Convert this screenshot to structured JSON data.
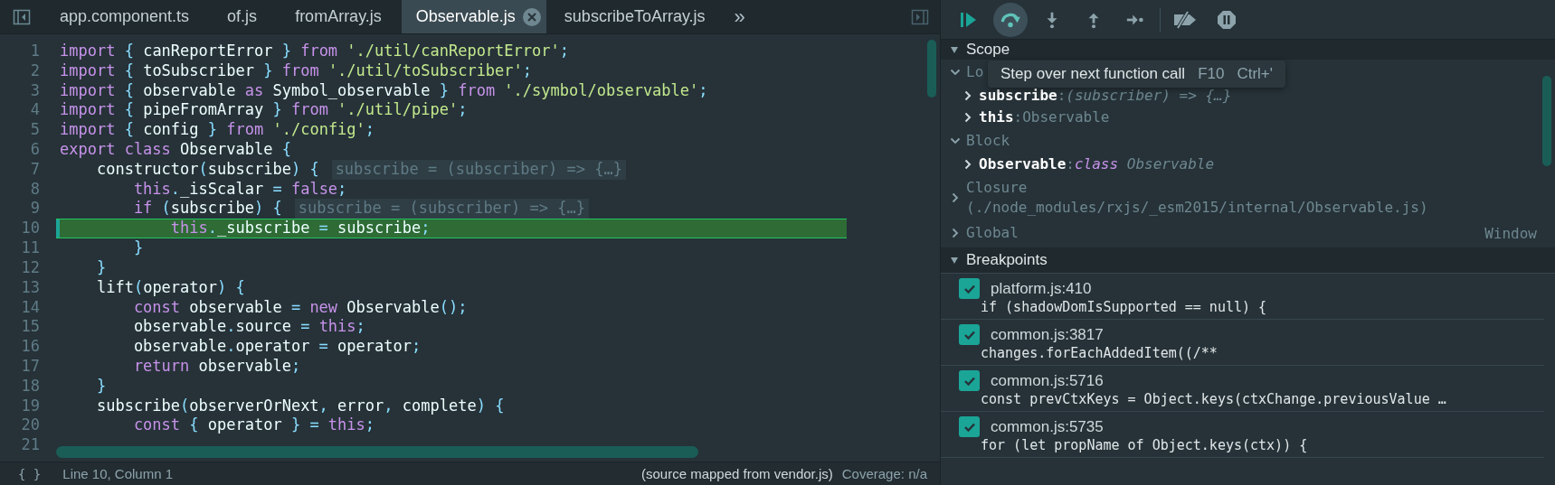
{
  "tabs": [
    {
      "label": "app.component.ts",
      "selected": false
    },
    {
      "label": "of.js",
      "selected": false
    },
    {
      "label": "fromArray.js",
      "selected": false
    },
    {
      "label": "Observable.js",
      "selected": true
    },
    {
      "label": "subscribeToArray.js",
      "selected": false
    }
  ],
  "tabs_overflow": "»",
  "code_lines": [
    {
      "number": "1",
      "current": false,
      "tokens": [
        {
          "kind": "keyword",
          "text": "import"
        },
        {
          "kind": "punct",
          "text": " { "
        },
        {
          "kind": "plain",
          "text": "canReportError"
        },
        {
          "kind": "punct",
          "text": " } "
        },
        {
          "kind": "keyword",
          "text": "from"
        },
        {
          "kind": "string",
          "text": " './util/canReportError'"
        },
        {
          "kind": "punct",
          "text": ";"
        }
      ]
    },
    {
      "number": "2",
      "current": false,
      "tokens": [
        {
          "kind": "keyword",
          "text": "import"
        },
        {
          "kind": "punct",
          "text": " { "
        },
        {
          "kind": "plain",
          "text": "toSubscriber"
        },
        {
          "kind": "punct",
          "text": " } "
        },
        {
          "kind": "keyword",
          "text": "from"
        },
        {
          "kind": "string",
          "text": " './util/toSubscriber'"
        },
        {
          "kind": "punct",
          "text": ";"
        }
      ]
    },
    {
      "number": "3",
      "current": false,
      "tokens": [
        {
          "kind": "keyword",
          "text": "import"
        },
        {
          "kind": "punct",
          "text": " { "
        },
        {
          "kind": "plain",
          "text": "observable "
        },
        {
          "kind": "keyword",
          "text": "as"
        },
        {
          "kind": "plain",
          "text": " Symbol_observable"
        },
        {
          "kind": "punct",
          "text": " } "
        },
        {
          "kind": "keyword",
          "text": "from"
        },
        {
          "kind": "string",
          "text": " './symbol/observable'"
        },
        {
          "kind": "punct",
          "text": ";"
        }
      ]
    },
    {
      "number": "4",
      "current": false,
      "tokens": [
        {
          "kind": "keyword",
          "text": "import"
        },
        {
          "kind": "punct",
          "text": " { "
        },
        {
          "kind": "plain",
          "text": "pipeFromArray"
        },
        {
          "kind": "punct",
          "text": " } "
        },
        {
          "kind": "keyword",
          "text": "from"
        },
        {
          "kind": "string",
          "text": " './util/pipe'"
        },
        {
          "kind": "punct",
          "text": ";"
        }
      ]
    },
    {
      "number": "5",
      "current": false,
      "tokens": [
        {
          "kind": "keyword",
          "text": "import"
        },
        {
          "kind": "punct",
          "text": " { "
        },
        {
          "kind": "plain",
          "text": "config"
        },
        {
          "kind": "punct",
          "text": " } "
        },
        {
          "kind": "keyword",
          "text": "from"
        },
        {
          "kind": "string",
          "text": " './config'"
        },
        {
          "kind": "punct",
          "text": ";"
        }
      ]
    },
    {
      "number": "6",
      "current": false,
      "tokens": [
        {
          "kind": "keyword",
          "text": "export class"
        },
        {
          "kind": "plain",
          "text": " Observable"
        },
        {
          "kind": "punct",
          "text": " {"
        }
      ]
    },
    {
      "number": "7",
      "current": false,
      "tokens": [
        {
          "kind": "plain",
          "text": "    constructor"
        },
        {
          "kind": "punct",
          "text": "("
        },
        {
          "kind": "plain",
          "text": "subscribe"
        },
        {
          "kind": "punct",
          "text": ") {"
        }
      ],
      "hint": "subscribe = (subscriber) => {…}"
    },
    {
      "number": "8",
      "current": false,
      "tokens": [
        {
          "kind": "keyword",
          "text": "        this"
        },
        {
          "kind": "punct",
          "text": "."
        },
        {
          "kind": "plain",
          "text": "_isScalar"
        },
        {
          "kind": "punct",
          "text": " = "
        },
        {
          "kind": "keyword",
          "text": "false"
        },
        {
          "kind": "punct",
          "text": ";"
        }
      ]
    },
    {
      "number": "9",
      "current": false,
      "tokens": [
        {
          "kind": "keyword",
          "text": "        if"
        },
        {
          "kind": "punct",
          "text": " ("
        },
        {
          "kind": "plain",
          "text": "subscribe"
        },
        {
          "kind": "punct",
          "text": ") {"
        }
      ],
      "hint": "subscribe = (subscriber) => {…}"
    },
    {
      "number": "10",
      "current": true,
      "tokens": [
        {
          "kind": "keyword",
          "text": "            this"
        },
        {
          "kind": "punct",
          "text": "."
        },
        {
          "kind": "plain",
          "text": "_subscribe"
        },
        {
          "kind": "punct",
          "text": " = "
        },
        {
          "kind": "plain",
          "text": "subscribe"
        },
        {
          "kind": "punct",
          "text": ";"
        }
      ]
    },
    {
      "number": "11",
      "current": false,
      "tokens": [
        {
          "kind": "punct",
          "text": "        }"
        }
      ]
    },
    {
      "number": "12",
      "current": false,
      "tokens": [
        {
          "kind": "punct",
          "text": "    }"
        }
      ]
    },
    {
      "number": "13",
      "current": false,
      "tokens": [
        {
          "kind": "plain",
          "text": "    lift"
        },
        {
          "kind": "punct",
          "text": "("
        },
        {
          "kind": "plain",
          "text": "operator"
        },
        {
          "kind": "punct",
          "text": ") {"
        }
      ]
    },
    {
      "number": "14",
      "current": false,
      "tokens": [
        {
          "kind": "keyword",
          "text": "        const"
        },
        {
          "kind": "plain",
          "text": " observable"
        },
        {
          "kind": "punct",
          "text": " = "
        },
        {
          "kind": "keyword",
          "text": "new"
        },
        {
          "kind": "plain",
          "text": " Observable"
        },
        {
          "kind": "punct",
          "text": "();"
        }
      ]
    },
    {
      "number": "15",
      "current": false,
      "tokens": [
        {
          "kind": "plain",
          "text": "        observable"
        },
        {
          "kind": "punct",
          "text": "."
        },
        {
          "kind": "plain",
          "text": "source"
        },
        {
          "kind": "punct",
          "text": " = "
        },
        {
          "kind": "keyword",
          "text": "this"
        },
        {
          "kind": "punct",
          "text": ";"
        }
      ]
    },
    {
      "number": "16",
      "current": false,
      "tokens": [
        {
          "kind": "plain",
          "text": "        observable"
        },
        {
          "kind": "punct",
          "text": "."
        },
        {
          "kind": "plain",
          "text": "operator"
        },
        {
          "kind": "punct",
          "text": " = "
        },
        {
          "kind": "plain",
          "text": "operator"
        },
        {
          "kind": "punct",
          "text": ";"
        }
      ]
    },
    {
      "number": "17",
      "current": false,
      "tokens": [
        {
          "kind": "keyword",
          "text": "        return"
        },
        {
          "kind": "plain",
          "text": " observable"
        },
        {
          "kind": "punct",
          "text": ";"
        }
      ]
    },
    {
      "number": "18",
      "current": false,
      "tokens": [
        {
          "kind": "punct",
          "text": "    }"
        }
      ]
    },
    {
      "number": "19",
      "current": false,
      "tokens": [
        {
          "kind": "plain",
          "text": "    subscribe"
        },
        {
          "kind": "punct",
          "text": "("
        },
        {
          "kind": "plain",
          "text": "observerOrNext"
        },
        {
          "kind": "punct",
          "text": ", "
        },
        {
          "kind": "plain",
          "text": "error"
        },
        {
          "kind": "punct",
          "text": ", "
        },
        {
          "kind": "plain",
          "text": "complete"
        },
        {
          "kind": "punct",
          "text": ") {"
        }
      ]
    },
    {
      "number": "20",
      "current": false,
      "tokens": [
        {
          "kind": "keyword",
          "text": "        const"
        },
        {
          "kind": "punct",
          "text": " { "
        },
        {
          "kind": "plain",
          "text": "operator"
        },
        {
          "kind": "punct",
          "text": " } = "
        },
        {
          "kind": "keyword",
          "text": "this"
        },
        {
          "kind": "punct",
          "text": ";"
        }
      ]
    },
    {
      "number": "21",
      "current": false
    }
  ],
  "status_bar": {
    "format_button": "{ }",
    "position": "Line 10, Column 1",
    "source_map": "(source mapped from vendor.js)",
    "coverage": "Coverage: n/a"
  },
  "debugger_toolbar": [
    {
      "kind": "resume",
      "highlighted": false
    },
    {
      "kind": "step-over",
      "highlighted": true
    },
    {
      "kind": "step-into",
      "highlighted": false
    },
    {
      "kind": "step-out",
      "highlighted": false
    },
    {
      "kind": "step",
      "highlighted": false
    },
    {
      "kind": "deactivate",
      "highlighted": false
    },
    {
      "kind": "pause-exceptions",
      "highlighted": false
    }
  ],
  "tooltip": {
    "text": "Step over next function call",
    "keys": [
      "F10",
      "Ctrl+'"
    ]
  },
  "scope": {
    "title": "Scope",
    "expanded": true,
    "groups": [
      {
        "label": "Lo",
        "expanded": true,
        "children": [
          {
            "name": "subscribe",
            "separator": ":",
            "kind": "function",
            "value": "(subscriber) => {…}",
            "expanded": false
          },
          {
            "name": "this",
            "separator": ":",
            "kind": "object",
            "value": "Observable",
            "expanded": false
          }
        ]
      },
      {
        "label": "Block",
        "expanded": true,
        "children": [
          {
            "name": "Observable",
            "separator": ":",
            "kind": "class",
            "keyword": "class",
            "value": "Observable",
            "expanded": false
          }
        ]
      },
      {
        "label": "Closure",
        "detail": "(./node_modules/rxjs/_esm2015/internal/Observable.js)",
        "expanded": false
      },
      {
        "label": "Global",
        "value": "Window",
        "expanded": false
      }
    ]
  },
  "breakpoints": {
    "title": "Breakpoints",
    "expanded": true,
    "items": [
      {
        "location": "platform.js:410",
        "code": "if (shadowDomIsSupported == null) {",
        "checked": true
      },
      {
        "location": "common.js:3817",
        "code": "changes.forEachAddedItem((/**",
        "checked": true
      },
      {
        "location": "common.js:5716",
        "code": "const prevCtxKeys = Object.keys(ctxChange.previousValue …",
        "checked": true
      },
      {
        "location": "common.js:5735",
        "code": "for (let propName of Object.keys(ctx)) {",
        "checked": true
      }
    ]
  }
}
